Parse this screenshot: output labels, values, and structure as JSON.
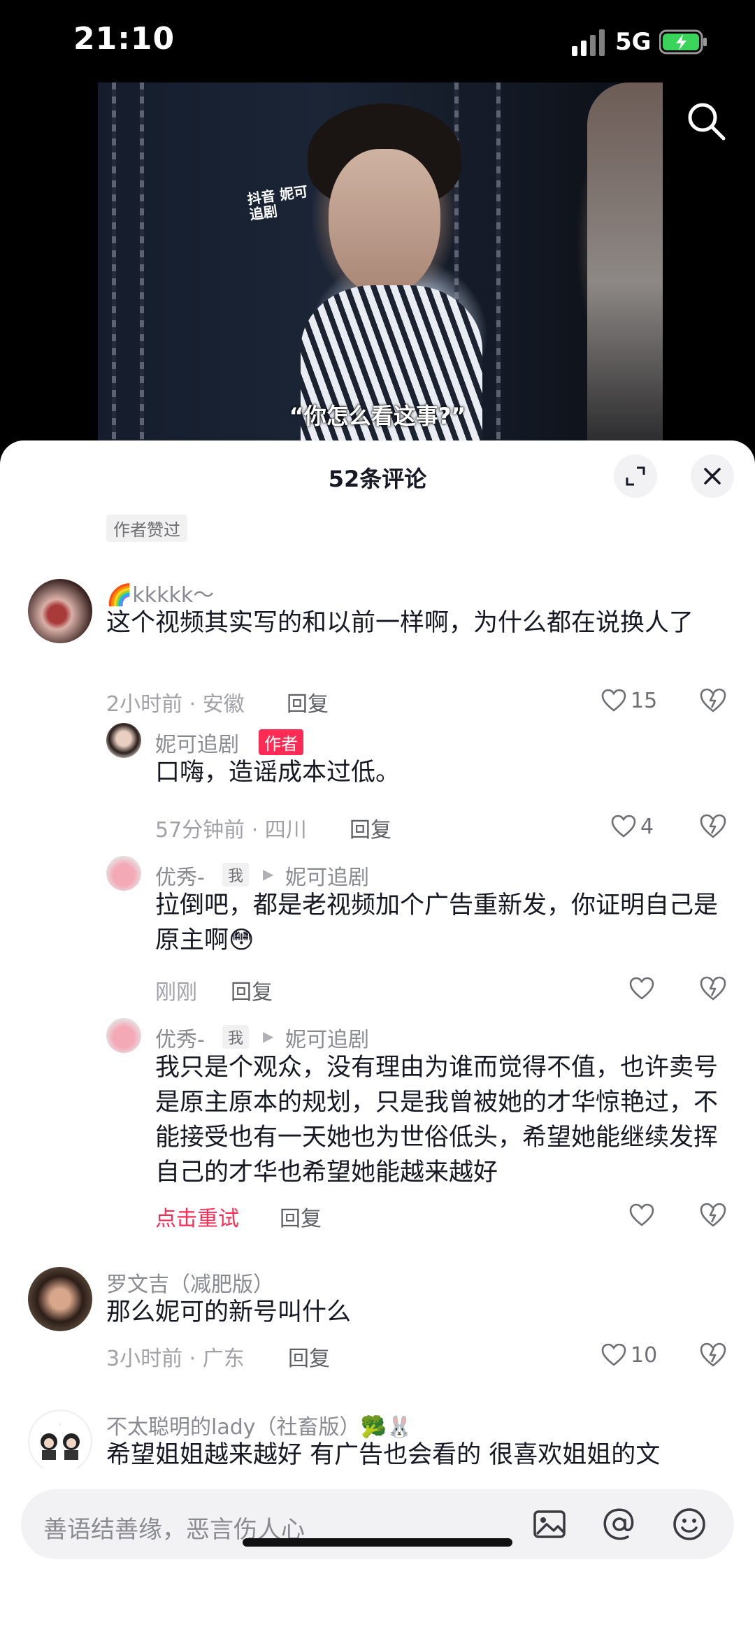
{
  "status_bar": {
    "time": "21:10",
    "network": "5G"
  },
  "video": {
    "watermark": "抖音 妮可追剧",
    "subtitle": "“你怎么看这事?”"
  },
  "sheet": {
    "title": "52条评论",
    "liked_by_author": "作者赞过"
  },
  "comments": [
    {
      "user": "🌈kkkkk～",
      "text": "这个视频其实写的和以前一样啊，为什么都在说换人了",
      "meta": "2小时前 · 安徽",
      "reply": "回复",
      "likes": "15"
    },
    {
      "user": "妮可追剧",
      "badge": "作者",
      "text": "口嗨，造谣成本过低。",
      "meta": "57分钟前 · 四川",
      "reply": "回复",
      "likes": "4"
    },
    {
      "user": "优秀-",
      "me_badge": "我",
      "reply_to": "妮可追剧",
      "text": "拉倒吧，都是老视频加个广告重新发，你证明自己是原主啊😳",
      "meta": "刚刚",
      "reply": "回复",
      "likes": ""
    },
    {
      "user": "优秀-",
      "me_badge": "我",
      "reply_to": "妮可追剧",
      "text": "我只是个观众，没有理由为谁而觉得不值，也许卖号是原主原本的规划，只是我曾被她的才华惊艳过，不能接受也有一天她也为世俗低头，希望她能继续发挥自己的才华也希望她能越来越好",
      "retry": "点击重试",
      "reply": "回复",
      "likes": ""
    },
    {
      "user": "罗文吉（减肥版）",
      "text": "那么妮可的新号叫什么",
      "meta": "3小时前 · 广东",
      "reply": "回复",
      "likes": "10"
    },
    {
      "user": "不太聪明的lady（社畜版）🥦🐰",
      "text": "希望姐姐越来越好 有广告也会看的 很喜欢姐姐的文"
    }
  ],
  "input": {
    "placeholder": "善语结善缘，恶言伤人心"
  },
  "icons": [
    "search-icon",
    "expand-icon",
    "close-icon",
    "heart-icon",
    "dislike-icon",
    "image-icon",
    "at-icon",
    "emoji-icon"
  ]
}
